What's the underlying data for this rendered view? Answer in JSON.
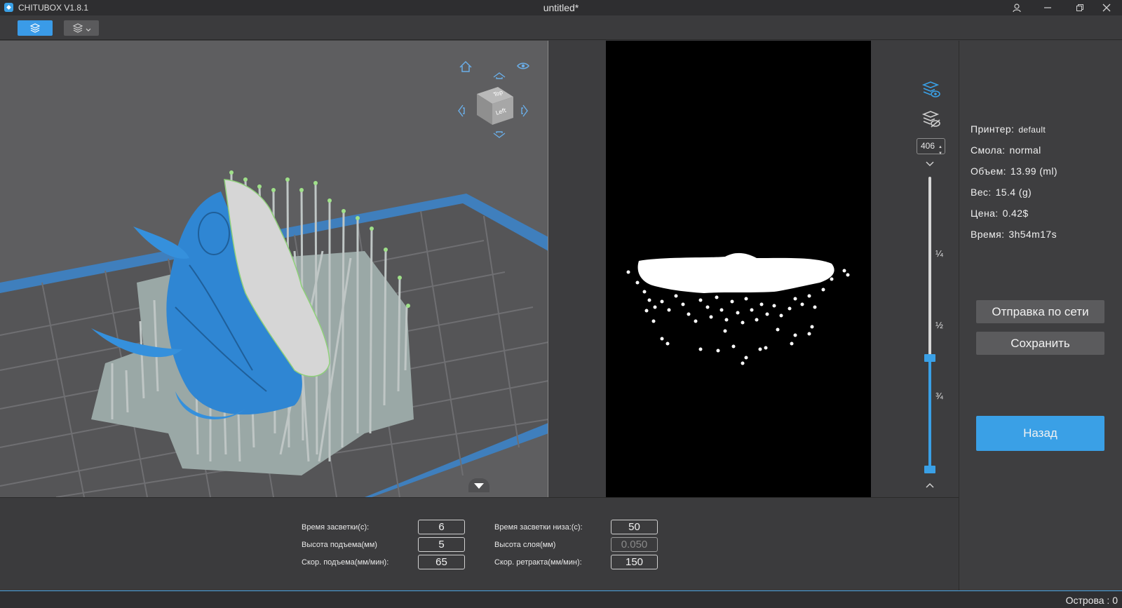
{
  "app": {
    "name": "CHITUBOX V1.8.1",
    "document_title": "untitled*"
  },
  "icons": {
    "app_logo": "chitubox-logo-icon",
    "user": "user-icon",
    "minimize": "minimize-icon",
    "restore": "restore-icon",
    "close": "close-icon",
    "home": "home-icon",
    "eye": "eye-icon",
    "layers_view": "layers-eye-icon",
    "layers_hide": "layers-hide-icon"
  },
  "view_cube": {
    "top_label": "Top",
    "front_label": "Left"
  },
  "layer_slider": {
    "current_layer": "406",
    "marks": [
      "¼",
      "½",
      "¾"
    ],
    "position_fraction": 0.38
  },
  "printer_info": {
    "printer_label": "Принтер:",
    "printer_value": "default",
    "resin_label": "Смола:",
    "resin_value": "normal",
    "volume_label": "Объем:",
    "volume_value": "13.99  (ml)",
    "weight_label": "Вес:",
    "weight_value": "15.4  (g)",
    "price_label": "Цена:",
    "price_value": "0.42$",
    "time_label": "Время:",
    "time_value": "3h54m17s"
  },
  "buttons": {
    "network_send": "Отправка по сети",
    "save": "Сохранить",
    "back": "Назад"
  },
  "params": {
    "exposure_label": "Время засветки(с):",
    "exposure_value": "6",
    "bottom_exposure_label": "Время засветки низа:(с):",
    "bottom_exposure_value": "50",
    "lift_height_label": "Высота подъема(мм)",
    "lift_height_value": "5",
    "layer_height_label": "Высота слоя(мм)",
    "layer_height_value": "0.050",
    "lift_speed_label": "Скор. подъема(мм/мин):",
    "lift_speed_value": "65",
    "retract_speed_label": "Скор. ретракта(мм/мин):",
    "retract_speed_value": "150"
  },
  "status": {
    "islands": "Острова : 0"
  },
  "colors": {
    "accent": "#3aa0e6",
    "model_blue": "#2f86d3",
    "support_gray": "#b8c0c0",
    "build_plate": "#9aa8a6"
  }
}
